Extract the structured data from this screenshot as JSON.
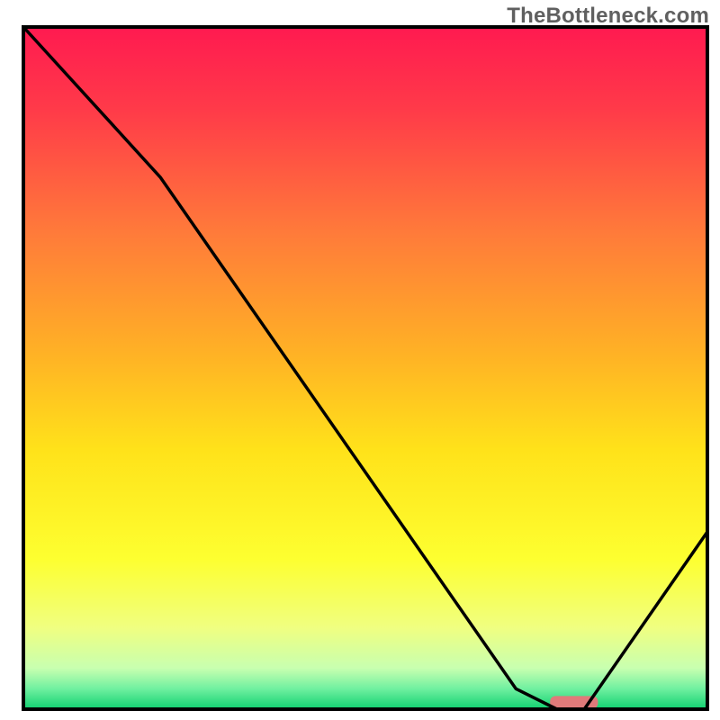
{
  "watermark": "TheBottleneck.com",
  "chart_data": {
    "type": "line",
    "title": "",
    "xlabel": "",
    "ylabel": "",
    "xlim": [
      0,
      100
    ],
    "ylim": [
      0,
      100
    ],
    "grid": false,
    "note": "No axis ticks or labels are visible in the image; x and y are normalized percentages of the plotting area.",
    "series": [
      {
        "name": "bottleneck-curve",
        "x": [
          0,
          20,
          72,
          78,
          82,
          100
        ],
        "y": [
          100,
          78,
          3,
          0,
          0,
          26
        ]
      }
    ],
    "indicator_bar": {
      "x_start": 77,
      "x_end": 84,
      "y": 1,
      "color": "#e07a7a",
      "description": "short horizontal pink/red bar marking the optimal point near the curve's minimum"
    },
    "background_gradient_stops": [
      {
        "offset": 0.0,
        "color": "#ff1a50"
      },
      {
        "offset": 0.12,
        "color": "#ff3a49"
      },
      {
        "offset": 0.3,
        "color": "#ff7a3a"
      },
      {
        "offset": 0.48,
        "color": "#ffb225"
      },
      {
        "offset": 0.62,
        "color": "#ffe21a"
      },
      {
        "offset": 0.78,
        "color": "#fdff30"
      },
      {
        "offset": 0.88,
        "color": "#f0ff80"
      },
      {
        "offset": 0.94,
        "color": "#c8ffb0"
      },
      {
        "offset": 0.97,
        "color": "#70f0a0"
      },
      {
        "offset": 1.0,
        "color": "#10d070"
      }
    ],
    "frame_color": "#000000",
    "curve_color": "#000000"
  }
}
